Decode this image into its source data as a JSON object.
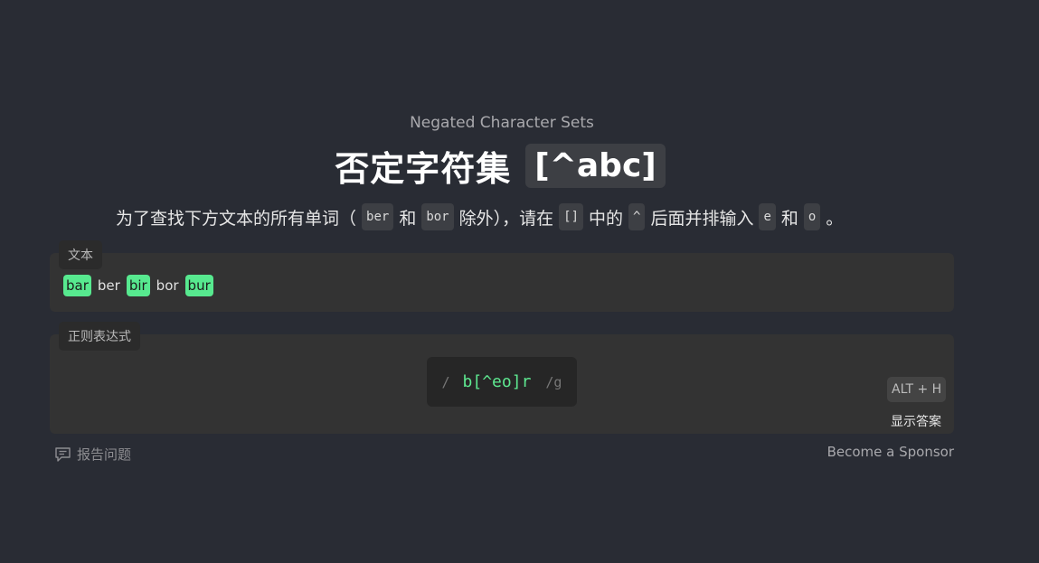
{
  "lesson": {
    "subtitle": "Negated Character Sets",
    "title": "否定字符集",
    "title_code": "[^abc]"
  },
  "description": {
    "part1": "为了查找下方文本的所有单词（",
    "code1": "ber",
    "part2": "和",
    "code2": "bor",
    "part3": "除外），请在",
    "code3": "[]",
    "part4": "中的",
    "code4": "^",
    "part5": "后面并排输入",
    "code5": "e",
    "part6": "和",
    "code6": "o",
    "part7": "。"
  },
  "text_panel": {
    "label": "文本",
    "words": [
      {
        "text": "bar",
        "matched": true
      },
      {
        "text": "ber",
        "matched": false
      },
      {
        "text": "bir",
        "matched": true
      },
      {
        "text": "bor",
        "matched": false
      },
      {
        "text": "bur",
        "matched": true
      }
    ]
  },
  "regex_panel": {
    "label": "正则表达式",
    "open_slash": "/",
    "value": "b[^eo]r",
    "flags": "/g",
    "hint_key": "ALT + H",
    "hint_label": "显示答案"
  },
  "footer": {
    "report": "报告问题",
    "sponsor": "Become a Sponsor"
  },
  "colors": {
    "background": "#292c34",
    "panel": "#333333",
    "match_highlight": "#57e98f",
    "regex_text": "#5ee890"
  }
}
